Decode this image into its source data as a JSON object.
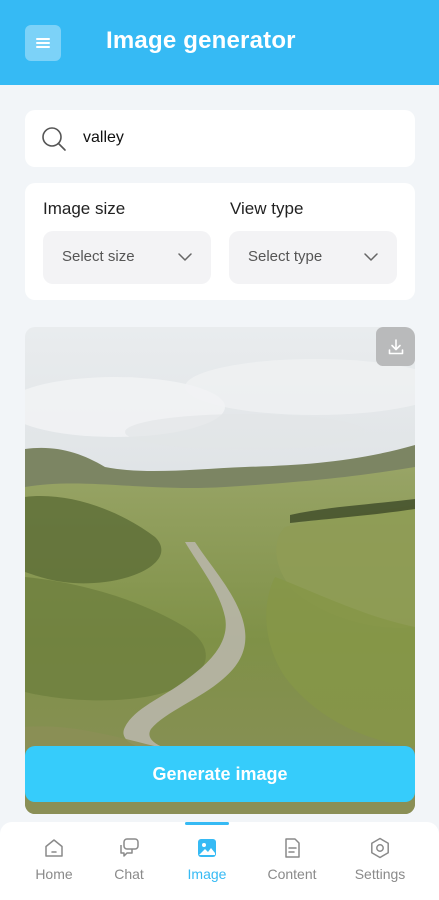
{
  "header": {
    "title": "Image generator",
    "menu_icon": "hamburger-menu-icon",
    "background": "#36baf4"
  },
  "search": {
    "value": "valley",
    "icon": "search-icon"
  },
  "options": {
    "image_size": {
      "label": "Image size",
      "selected": "Select size"
    },
    "view_type": {
      "label": "View type",
      "selected": "Select type"
    }
  },
  "preview": {
    "description_icon": "download-icon"
  },
  "generate_button": {
    "label": "Generate image",
    "color": "#36ccfb"
  },
  "nav": {
    "items": [
      {
        "label": "Home",
        "icon": "home-icon",
        "active": false
      },
      {
        "label": "Chat",
        "icon": "chat-icon",
        "active": false
      },
      {
        "label": "Image",
        "icon": "image-icon",
        "active": true
      },
      {
        "label": "Content",
        "icon": "document-icon",
        "active": false
      },
      {
        "label": "Settings",
        "icon": "settings-icon",
        "active": false
      }
    ],
    "active_color": "#36baf4"
  }
}
